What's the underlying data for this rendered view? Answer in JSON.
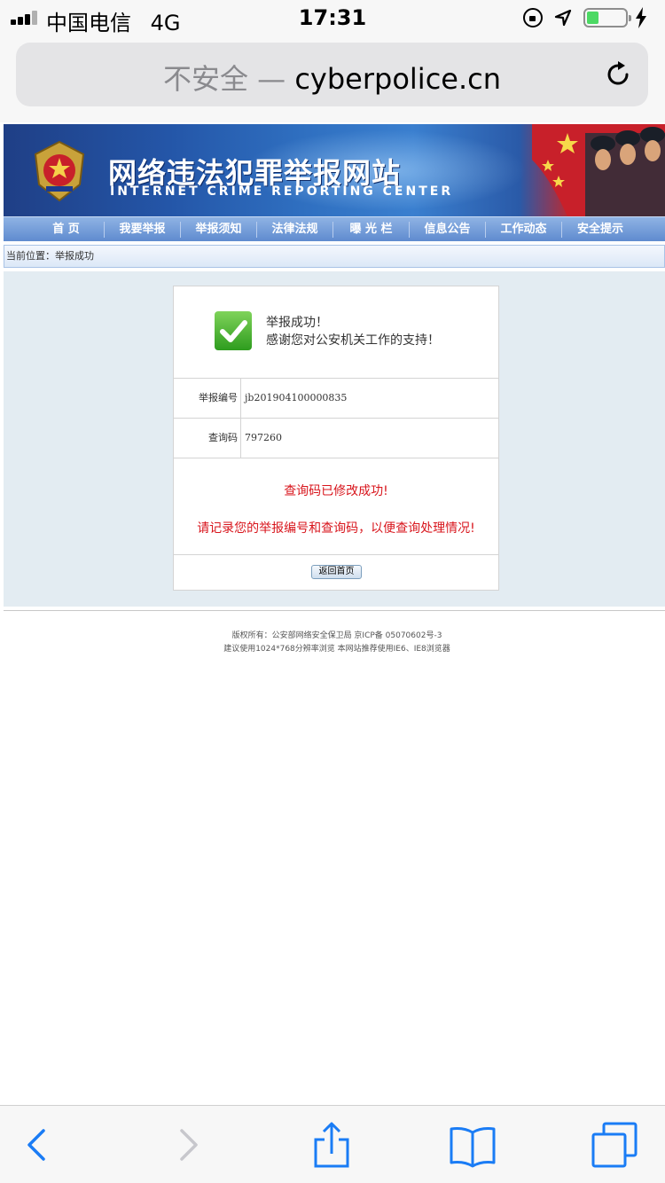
{
  "status_bar": {
    "carrier": "中国电信",
    "network": "4G",
    "time": "17:31",
    "battery_level": 0.3
  },
  "address_bar": {
    "insecure_label": "不安全",
    "separator": " — ",
    "domain": "cyberpolice.cn"
  },
  "banner": {
    "title": "网络违法犯罪举报网站",
    "subtitle": "INTERNET CRIME REPORTING CENTER"
  },
  "nav": {
    "items": [
      "首 页",
      "我要举报",
      "举报须知",
      "法律法规",
      "曝 光 栏",
      "信息公告",
      "工作动态",
      "安全提示"
    ]
  },
  "breadcrumb": {
    "text": "当前位置：举报成功"
  },
  "result": {
    "title": "举报成功！",
    "message": "感谢您对公安机关工作的支持！",
    "report_number_label": "举报编号",
    "report_number": "jb201904100000835",
    "query_code_label": "查询码",
    "query_code": "797260",
    "notice_1": "查询码已修改成功!",
    "notice_2": "请记录您的举报编号和查询码，以便查询处理情况!",
    "back_button": "返回首页"
  },
  "footer": {
    "line1": "版权所有：公安部网络安全保卫局 京ICP备 05070602号-3",
    "line2": "建议使用1024*768分辨率浏览 本网站推荐使用IE6、IE8浏览器"
  },
  "colors": {
    "notice_red": "#d8151c",
    "ios_blue": "#1a7cf5",
    "battery_green": "#4cd964"
  },
  "icons": [
    "signal-icon",
    "orientation-lock-icon",
    "location-icon",
    "battery-icon",
    "charging-icon",
    "reload-icon",
    "police-emblem-icon",
    "checkmark-icon",
    "back-icon",
    "forward-icon",
    "share-icon",
    "bookmarks-icon",
    "tabs-icon"
  ]
}
